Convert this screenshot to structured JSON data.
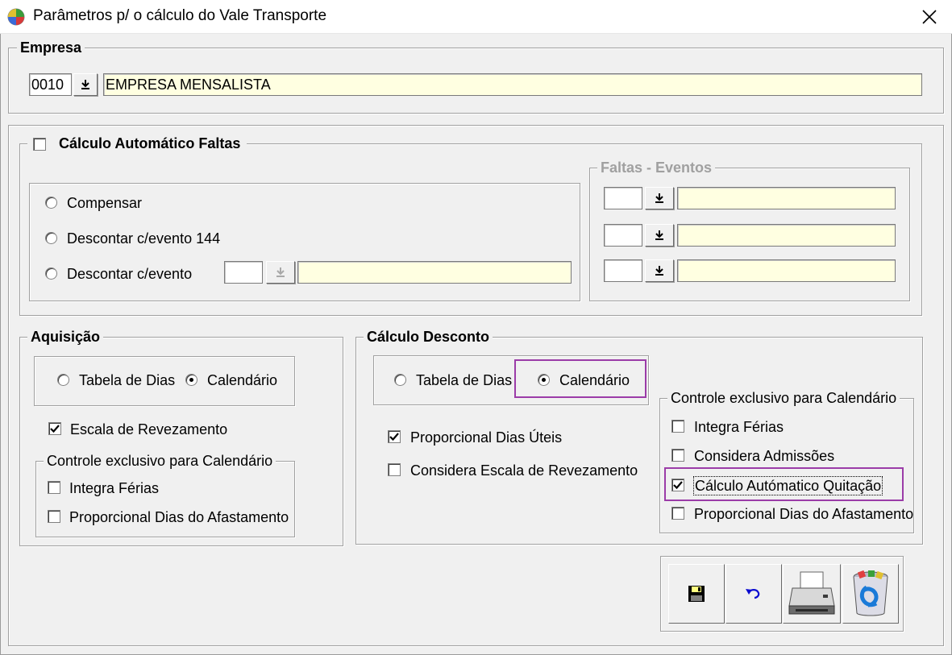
{
  "window": {
    "title": "Parâmetros p/ o cálculo do Vale Transporte"
  },
  "empresa": {
    "legend": "Empresa",
    "code": "0010",
    "name": "EMPRESA MENSALISTA"
  },
  "faltas": {
    "auto_label": "Cálculo Automático Faltas",
    "auto_checked": false,
    "options": {
      "compensar": "Compensar",
      "descontar_144": "Descontar c/evento 144",
      "descontar_evento": "Descontar c/evento"
    },
    "eventos_legend": "Faltas - Eventos"
  },
  "aquisicao": {
    "legend": "Aquisição",
    "tabela_dias": "Tabela de Dias",
    "calendario": "Calendário",
    "selected": "calendario",
    "escala_revezamento": "Escala de Revezamento",
    "controle_legend": "Controle exclusivo para Calendário",
    "integra_ferias": "Integra Férias",
    "proporcional_afastamento": "Proporcional Dias do Afastamento"
  },
  "desconto": {
    "legend": "Cálculo Desconto",
    "tabela_dias": "Tabela de Dias",
    "calendario": "Calendário",
    "selected": "calendario",
    "proporcional_uteis": "Proporcional Dias Úteis",
    "considera_escala": "Considera Escala de Revezamento",
    "controle_legend": "Controle exclusivo para Calendário",
    "integra_ferias": "Integra Férias",
    "considera_admissoes": "Considera Admissões",
    "calculo_quitacao": "Cálculo Autómatico Quitação",
    "proporcional_afastamento": "Proporcional Dias do Afastamento"
  },
  "toolbar": {
    "icons": [
      "save-icon",
      "undo-icon",
      "printer-icon",
      "recycle-bin-icon"
    ]
  },
  "colors": {
    "highlight": "#9b3ca8",
    "field_yellow": "#ffffe1",
    "background": "#f0f0f0"
  }
}
